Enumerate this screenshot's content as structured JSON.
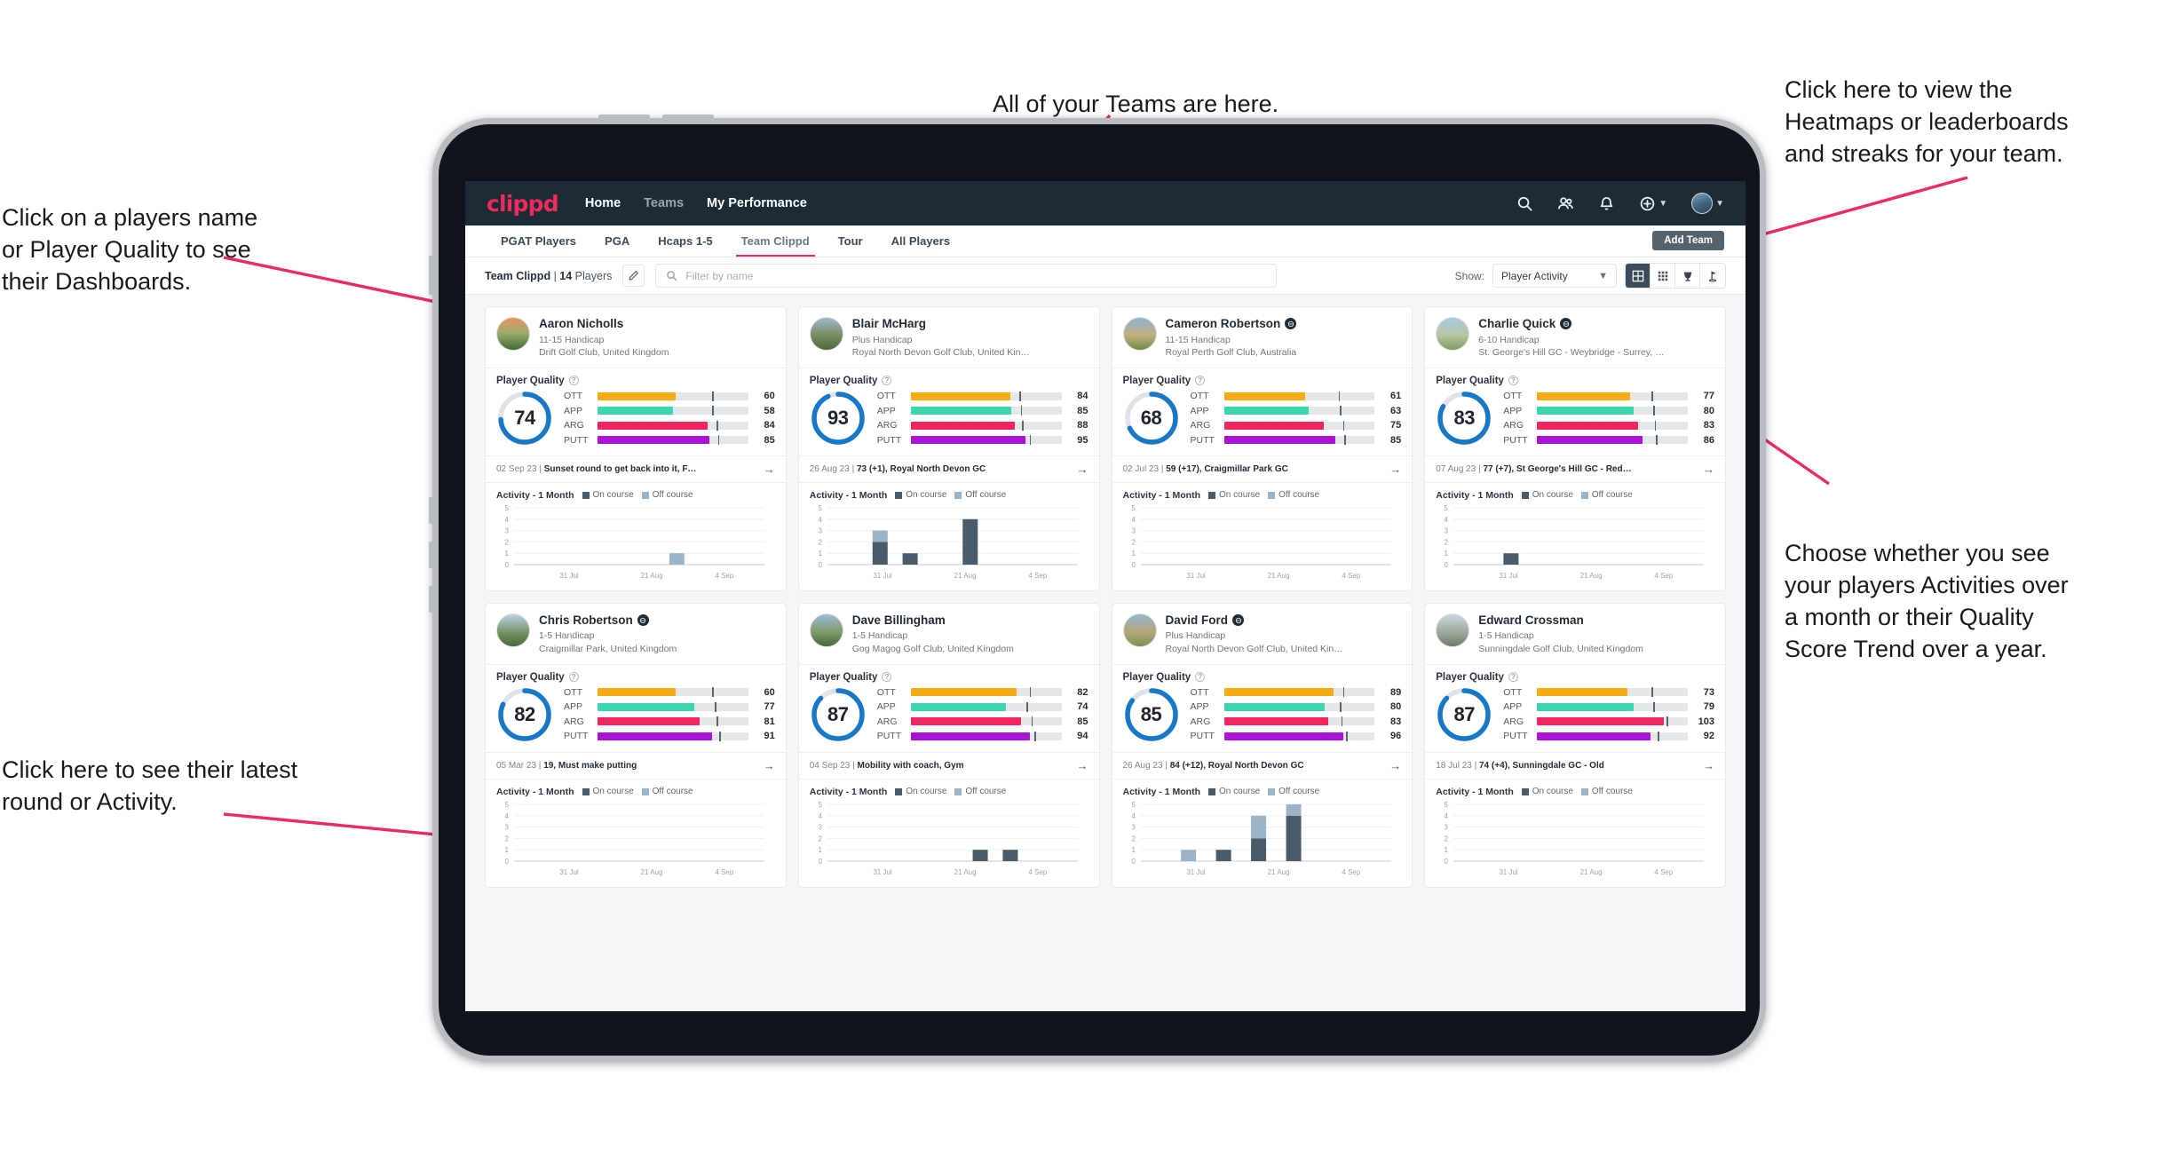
{
  "annotations": [
    {
      "id": "teams",
      "text": "All of your Teams are here."
    },
    {
      "id": "heatmaps",
      "text": "Click here to view the\nHeatmaps or leaderboards\nand streaks for your team."
    },
    {
      "id": "playername",
      "text": "Click on a players name\nor Player Quality to see\ntheir Dashboards."
    },
    {
      "id": "choose",
      "text": "Choose whether you see\nyour players Activities over\na month or their Quality\nScore Trend over a year."
    },
    {
      "id": "latest",
      "text": "Click here to see their latest\nround or Activity."
    }
  ],
  "nav": {
    "brand": "clippd",
    "links": [
      {
        "label": "Home",
        "active": true
      },
      {
        "label": "Teams",
        "active": false
      },
      {
        "label": "My Performance",
        "active": true
      }
    ],
    "icons": [
      "search-icon",
      "people-icon",
      "bell-icon",
      "plus-circle-icon",
      "avatar"
    ]
  },
  "tabs": [
    {
      "label": "PGAT Players",
      "active": false
    },
    {
      "label": "PGA",
      "active": false
    },
    {
      "label": "Hcaps 1-5",
      "active": false
    },
    {
      "label": "Team Clippd",
      "active": true
    },
    {
      "label": "Tour",
      "active": false
    },
    {
      "label": "All Players",
      "active": false
    }
  ],
  "add_team_label": "Add Team",
  "toolbar": {
    "team_name": "Team Clippd",
    "separator": " | ",
    "player_count": "14",
    "players_word": " Players",
    "edit_icon": "pencil-icon",
    "search_placeholder": "Filter by name",
    "show_label": "Show:",
    "show_value": "Player Activity",
    "views": [
      "grid-view-icon",
      "dense-grid-icon",
      "trophy-icon",
      "golf-flag-icon"
    ]
  },
  "colors": {
    "accent_pink": "#ef2a5d",
    "nav_bg": "#1d2b36",
    "gauge_blue": "#1878c8",
    "ott": "#f6ab10",
    "app": "#3bd6b0",
    "arg": "#f4245e",
    "putt": "#a913d6",
    "on_course": "#4a5b69",
    "off_course": "#9cb4c9"
  },
  "metric_labels": [
    "OTT",
    "APP",
    "ARG",
    "PUTT"
  ],
  "activity": {
    "title": "Activity - 1 Month",
    "legend_on": "On course",
    "legend_off": "Off course",
    "y_ticks": [
      "5",
      "4",
      "3",
      "2",
      "1",
      "0"
    ],
    "x_ticks": [
      "31 Jul",
      "21 Aug",
      "4 Sep"
    ],
    "y_max": 5
  },
  "player_quality_label": "Player Quality",
  "players": [
    {
      "name": "Aaron Nicholls",
      "verified": false,
      "handicap": "11-15 Handicap",
      "club": "Drift Golf Club, United Kingdom",
      "score": 74,
      "metrics": [
        {
          "label": "OTT",
          "value": 60,
          "fill": 52,
          "tick": 76
        },
        {
          "label": "APP",
          "value": 58,
          "fill": 50,
          "tick": 76
        },
        {
          "label": "ARG",
          "value": 84,
          "fill": 73,
          "tick": 79
        },
        {
          "label": "PUTT",
          "value": 85,
          "fill": 74,
          "tick": 80
        }
      ],
      "round_date": "02 Sep 23",
      "round_text": "Sunset round to get back into it, F…",
      "chart_bars": [
        {
          "x": 0.62,
          "on": 0,
          "off": 1
        }
      ]
    },
    {
      "name": "Blair McHarg",
      "verified": false,
      "handicap": "Plus Handicap",
      "club": "Royal North Devon Golf Club, United Kin…",
      "score": 93,
      "metrics": [
        {
          "label": "OTT",
          "value": 84,
          "fill": 66,
          "tick": 72
        },
        {
          "label": "APP",
          "value": 85,
          "fill": 67,
          "tick": 73
        },
        {
          "label": "ARG",
          "value": 88,
          "fill": 69,
          "tick": 74
        },
        {
          "label": "PUTT",
          "value": 95,
          "fill": 76,
          "tick": 79
        }
      ],
      "round_date": "26 Aug 23",
      "round_text": "73 (+1), Royal North Devon GC",
      "chart_bars": [
        {
          "x": 0.18,
          "on": 2,
          "off": 1
        },
        {
          "x": 0.3,
          "on": 1,
          "off": 0
        },
        {
          "x": 0.54,
          "on": 4,
          "off": 0
        }
      ]
    },
    {
      "name": "Cameron Robertson",
      "verified": true,
      "handicap": "11-15 Handicap",
      "club": "Royal Perth Golf Club, Australia",
      "score": 68,
      "metrics": [
        {
          "label": "OTT",
          "value": 61,
          "fill": 54,
          "tick": 76
        },
        {
          "label": "APP",
          "value": 63,
          "fill": 56,
          "tick": 77
        },
        {
          "label": "ARG",
          "value": 75,
          "fill": 66,
          "tick": 79
        },
        {
          "label": "PUTT",
          "value": 85,
          "fill": 74,
          "tick": 80
        }
      ],
      "round_date": "02 Jul 23",
      "round_text": "59 (+17), Craigmillar Park GC",
      "chart_bars": []
    },
    {
      "name": "Charlie Quick",
      "verified": true,
      "handicap": "6-10 Handicap",
      "club": "St. George's Hill GC - Weybridge - Surrey, …",
      "score": 83,
      "metrics": [
        {
          "label": "OTT",
          "value": 77,
          "fill": 62,
          "tick": 76
        },
        {
          "label": "APP",
          "value": 80,
          "fill": 64,
          "tick": 77
        },
        {
          "label": "ARG",
          "value": 83,
          "fill": 67,
          "tick": 78
        },
        {
          "label": "PUTT",
          "value": 86,
          "fill": 70,
          "tick": 79
        }
      ],
      "round_date": "07 Aug 23",
      "round_text": "77 (+7), St George's Hill GC - Red…",
      "chart_bars": [
        {
          "x": 0.2,
          "on": 1,
          "off": 0
        }
      ]
    },
    {
      "name": "Chris Robertson",
      "verified": true,
      "handicap": "1-5 Handicap",
      "club": "Craigmillar Park, United Kingdom",
      "score": 82,
      "metrics": [
        {
          "label": "OTT",
          "value": 60,
          "fill": 52,
          "tick": 76
        },
        {
          "label": "APP",
          "value": 77,
          "fill": 64,
          "tick": 78
        },
        {
          "label": "ARG",
          "value": 81,
          "fill": 68,
          "tick": 79
        },
        {
          "label": "PUTT",
          "value": 91,
          "fill": 76,
          "tick": 81
        }
      ],
      "round_date": "05 Mar 23",
      "round_text": "19, Must make putting",
      "chart_bars": []
    },
    {
      "name": "Dave Billingham",
      "verified": false,
      "handicap": "1-5 Handicap",
      "club": "Gog Magog Golf Club, United Kingdom",
      "score": 87,
      "metrics": [
        {
          "label": "OTT",
          "value": 82,
          "fill": 70,
          "tick": 79
        },
        {
          "label": "APP",
          "value": 74,
          "fill": 63,
          "tick": 77
        },
        {
          "label": "ARG",
          "value": 85,
          "fill": 73,
          "tick": 80
        },
        {
          "label": "PUTT",
          "value": 94,
          "fill": 79,
          "tick": 82
        }
      ],
      "round_date": "04 Sep 23",
      "round_text": "Mobility with coach, Gym",
      "chart_bars": [
        {
          "x": 0.58,
          "on": 1,
          "off": 0
        },
        {
          "x": 0.7,
          "on": 1,
          "off": 0
        }
      ]
    },
    {
      "name": "David Ford",
      "verified": true,
      "handicap": "Plus Handicap",
      "club": "Royal North Devon Golf Club, United Kin…",
      "score": 85,
      "metrics": [
        {
          "label": "OTT",
          "value": 89,
          "fill": 73,
          "tick": 79
        },
        {
          "label": "APP",
          "value": 80,
          "fill": 67,
          "tick": 77
        },
        {
          "label": "ARG",
          "value": 83,
          "fill": 69,
          "tick": 78
        },
        {
          "label": "PUTT",
          "value": 96,
          "fill": 79,
          "tick": 81
        }
      ],
      "round_date": "26 Aug 23",
      "round_text": "84 (+12), Royal North Devon GC",
      "chart_bars": [
        {
          "x": 0.16,
          "on": 0,
          "off": 1
        },
        {
          "x": 0.3,
          "on": 1,
          "off": 0
        },
        {
          "x": 0.44,
          "on": 2,
          "off": 2
        },
        {
          "x": 0.58,
          "on": 4,
          "off": 1
        }
      ]
    },
    {
      "name": "Edward Crossman",
      "verified": false,
      "handicap": "1-5 Handicap",
      "club": "Sunningdale Golf Club, United Kingdom",
      "score": 87,
      "metrics": [
        {
          "label": "OTT",
          "value": 73,
          "fill": 60,
          "tick": 76
        },
        {
          "label": "APP",
          "value": 79,
          "fill": 64,
          "tick": 77
        },
        {
          "label": "ARG",
          "value": 103,
          "fill": 84,
          "tick": 86
        },
        {
          "label": "PUTT",
          "value": 92,
          "fill": 75,
          "tick": 80
        }
      ],
      "round_date": "18 Jul 23",
      "round_text": "74 (+4), Sunningdale GC - Old",
      "chart_bars": []
    }
  ]
}
